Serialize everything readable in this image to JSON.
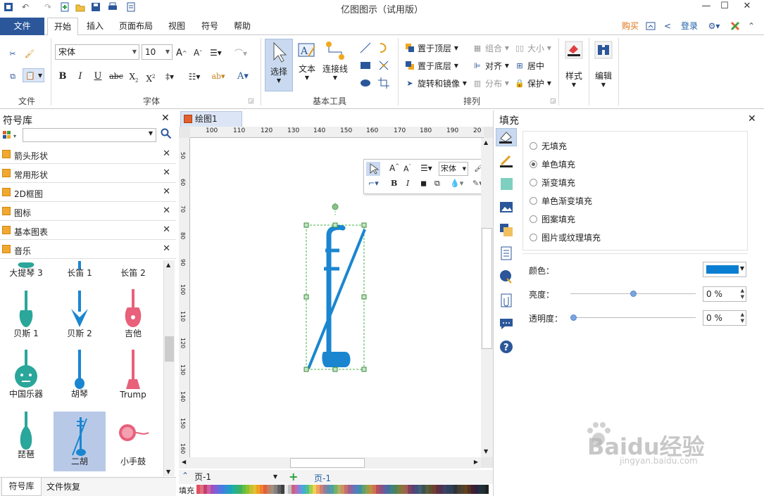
{
  "titlebar": {
    "app_title": "亿图图示（试用版）"
  },
  "menu": {
    "file": "文件",
    "tabs": [
      "开始",
      "插入",
      "页面布局",
      "视图",
      "符号",
      "帮助"
    ],
    "buy": "购买",
    "login": "登录"
  },
  "ribbon": {
    "file_group": "文件",
    "font_group": "字体",
    "font_name": "宋体",
    "font_size": "10",
    "basic_tools_group": "基本工具",
    "select": "选择",
    "text": "文本",
    "connector": "连接线",
    "arrange_group": "排列",
    "bring_front": "置于顶层",
    "send_back": "置于底层",
    "rotate_mirror": "旋转和镜像",
    "group": "组合",
    "align": "对齐",
    "distribute": "分布",
    "size": "大小",
    "center": "居中",
    "protect": "保护",
    "style": "样式",
    "edit": "编辑"
  },
  "library": {
    "title": "符号库",
    "categories": [
      "箭头形状",
      "常用形状",
      "2D框图",
      "图标",
      "基本图表",
      "音乐"
    ],
    "symbols": [
      {
        "label": "大提琴 3"
      },
      {
        "label": "长笛 1"
      },
      {
        "label": "长笛 2"
      },
      {
        "label": "贝斯 1"
      },
      {
        "label": "贝斯 2"
      },
      {
        "label": "吉他"
      },
      {
        "label": "中国乐器"
      },
      {
        "label": "胡琴"
      },
      {
        "label": "Trump"
      },
      {
        "label": "琵琶"
      },
      {
        "label": "二胡"
      },
      {
        "label": "小手鼓"
      }
    ],
    "bottom_tabs": [
      "符号库",
      "文件恢复"
    ]
  },
  "canvas": {
    "doc_tab": "绘图1",
    "ruler_h": [
      "100",
      "110",
      "120",
      "130",
      "140",
      "150",
      "160",
      "170",
      "180",
      "190",
      "20"
    ],
    "ruler_v": [
      "50",
      "60",
      "70",
      "80",
      "90",
      "100",
      "110",
      "120",
      "130",
      "140",
      "150",
      "160"
    ],
    "float_font": "宋体"
  },
  "pages": {
    "dropdown": "页-1",
    "active": "页-1",
    "fill_label": "填充"
  },
  "fill": {
    "title": "填充",
    "options": [
      "无填充",
      "单色填充",
      "渐变填充",
      "单色渐变填充",
      "图案填充",
      "图片或纹理填充"
    ],
    "selected_index": 1,
    "color_label": "颜色：",
    "color_value": "#0a7fd1",
    "brightness_label": "亮度：",
    "brightness_value": "0 %",
    "brightness_level": 0.5,
    "transparency_label": "透明度：",
    "transparency_value": "0 %",
    "transparency_level": 0.0
  },
  "watermark": {
    "brand": "Baidu经验",
    "url": "jingyan.baidu.com"
  },
  "colors": {
    "accent": "#2b579a",
    "instrument": "#1a86d0",
    "teal": "#2aa69a",
    "pink": "#e8607a"
  }
}
